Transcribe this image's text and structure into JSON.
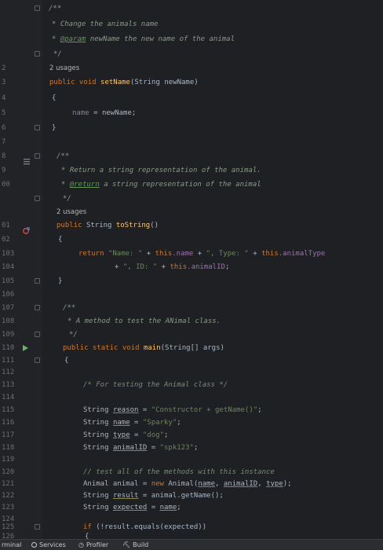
{
  "gutter": {
    "line_numbers": [
      "",
      "",
      "",
      "2",
      "3",
      "4",
      "5",
      "6",
      "7",
      "8",
      "9",
      "00",
      "",
      "",
      "",
      "",
      "",
      "",
      "",
      "",
      "",
      "",
      "",
      "",
      "",
      "01",
      "02",
      "103",
      "104",
      "105",
      "106",
      "107",
      "108",
      "109",
      "110",
      "111",
      "112",
      "113",
      "114",
      "115",
      "116",
      "117",
      "118",
      "119",
      "120",
      "121",
      "122",
      "123",
      "124",
      "125",
      "126"
    ]
  },
  "code": {
    "l1": "/**",
    "l2_star": "* ",
    "l2_text": "Change the animals name",
    "l3_star": "* ",
    "l3_tag": "@param",
    "l3_text": " newName the new name of the animal",
    "l4": "*/",
    "usages1": "2 usages",
    "l5_kw": "public void ",
    "l5_fn": "setName",
    "l5_rest": "(String newName)",
    "l6": "{",
    "l7_fld": "name",
    "l7_rest": " = newName;",
    "l8": "}",
    "l9": "/**",
    "l10_star": "* ",
    "l10_text": "Return a string representation of the animal.",
    "l11_star": "* ",
    "l11_tag": "@return",
    "l11_text": " a string representation of the animal",
    "l12": "*/",
    "usages2": "2 usages",
    "l13_kw": "public ",
    "l13_type": "String ",
    "l13_fn": "toString",
    "l13_rest": "()",
    "l14": "{",
    "l15_kw": "return ",
    "l15_s1": "\"Name: \"",
    "l15_p1": " + ",
    "l15_kw2": "this",
    "l15_f1": ".name",
    "l15_p2": " + ",
    "l15_s2": "\", Type: \"",
    "l15_p3": " + ",
    "l15_kw3": "this",
    "l15_f2": ".animalType",
    "l16_p1": "+ ",
    "l16_s1": "\", ID: \"",
    "l16_p2": " + ",
    "l16_kw": "this",
    "l16_f": ".animalID",
    "l16_end": ";",
    "l17": "}",
    "l18": "/**",
    "l19_star": "* ",
    "l19_text": "A method to test the ANimal class.",
    "l20": "*/",
    "l21_kw": "public static void ",
    "l21_fn": "main",
    "l21_rest": "(String[] args)",
    "l22": "{",
    "l23": "/* For testing the Animal class */",
    "l24_type": "String ",
    "l24_var": "reason",
    "l24_eq": " = ",
    "l24_str": "\"Constructor + getName()\"",
    "l24_end": ";",
    "l25_type": "String ",
    "l25_var": "name",
    "l25_eq": " = ",
    "l25_str": "\"Sparky\"",
    "l25_end": ";",
    "l26_type": "String ",
    "l26_var": "type",
    "l26_eq": " = ",
    "l26_str": "\"dog\"",
    "l26_end": ";",
    "l27_type": "String ",
    "l27_var": "animalID",
    "l27_eq": " = ",
    "l27_str": "\"spk123\"",
    "l27_end": ";",
    "l28": "// test all of the methods with this instance",
    "l29_a": "Animal animal = ",
    "l29_kw": "new ",
    "l29_b": "Animal(",
    "l29_v1": "name",
    "l29_c": ", ",
    "l29_v2": "animalID",
    "l29_d": ", ",
    "l29_v3": "type",
    "l29_e": ");",
    "l30_type": "String ",
    "l30_var": "result",
    "l30_rest": " = animal.getName();",
    "l31_type": "String ",
    "l31_var": "expected",
    "l31_eq": " = ",
    "l31_v2": "name",
    "l31_end": ";",
    "l32_kw": "if ",
    "l32_rest": "(!result.equals(expected))",
    "l33": "{"
  },
  "statusbar": {
    "terminal": "rminal",
    "services": "Services",
    "profiler": "Profiler",
    "build": "Build"
  },
  "colors": {
    "background": "#1f2023",
    "keyword": "#cc7832",
    "function": "#ffc66d",
    "field": "#9876aa",
    "string": "#6a8759",
    "comment": "#8a9a87",
    "run_icon": "#5fb85f"
  }
}
